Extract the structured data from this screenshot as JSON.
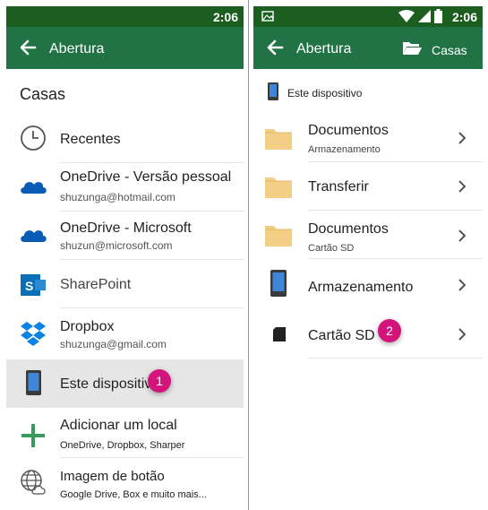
{
  "colors": {
    "statusbar": "#1b5e20",
    "appbar": "#217346",
    "badge": "#d4147a",
    "selected_row": "#e6e6e6"
  },
  "left": {
    "status_time": "2:06",
    "appbar_title": "Abertura",
    "section_title": "Casas",
    "items": [
      {
        "label": "Recentes",
        "sub": "",
        "icon": "clock-icon"
      },
      {
        "label": "OneDrive -  Versão pessoal",
        "sub": "shuzunga@hotmail.com",
        "icon": "onedrive-cloud-icon"
      },
      {
        "label": "OneDrive - Microsoft",
        "sub": "shuzun@microsoft.com",
        "icon": "onedrive-cloud-icon"
      },
      {
        "label": "SharePoint",
        "sub": "",
        "icon": "sharepoint-icon"
      },
      {
        "label": "Dropbox",
        "sub": "shuzunga@gmail.com",
        "icon": "dropbox-icon"
      },
      {
        "label": "Este dispositivo",
        "sub": "",
        "icon": "tablet-icon",
        "selected": true
      },
      {
        "label": "Adicionar um local",
        "sub": "OneDrive, Dropbox, Sharper",
        "icon": "plus-icon"
      },
      {
        "label": "Imagem de botão",
        "sub": "Google Drive, Box e muito mais...",
        "icon": "globe-cloud-icon"
      }
    ],
    "badge": "1"
  },
  "right": {
    "status_time": "2:06",
    "appbar_title": "Abertura",
    "appbar_action": "Casas",
    "header": "Este dispositivo",
    "items": [
      {
        "label": "Documentos",
        "sub": "Armazenamento",
        "icon": "folder-icon"
      },
      {
        "label": "Transferir",
        "sub": "",
        "icon": "folder-icon"
      },
      {
        "label": "Documentos",
        "sub": "Cartão SD",
        "icon": "folder-icon"
      },
      {
        "label": "Armazenamento",
        "sub": "",
        "icon": "tablet-icon"
      },
      {
        "label": "Cartão SD",
        "sub": "",
        "icon": "sd-card-icon"
      }
    ],
    "badge": "2"
  }
}
